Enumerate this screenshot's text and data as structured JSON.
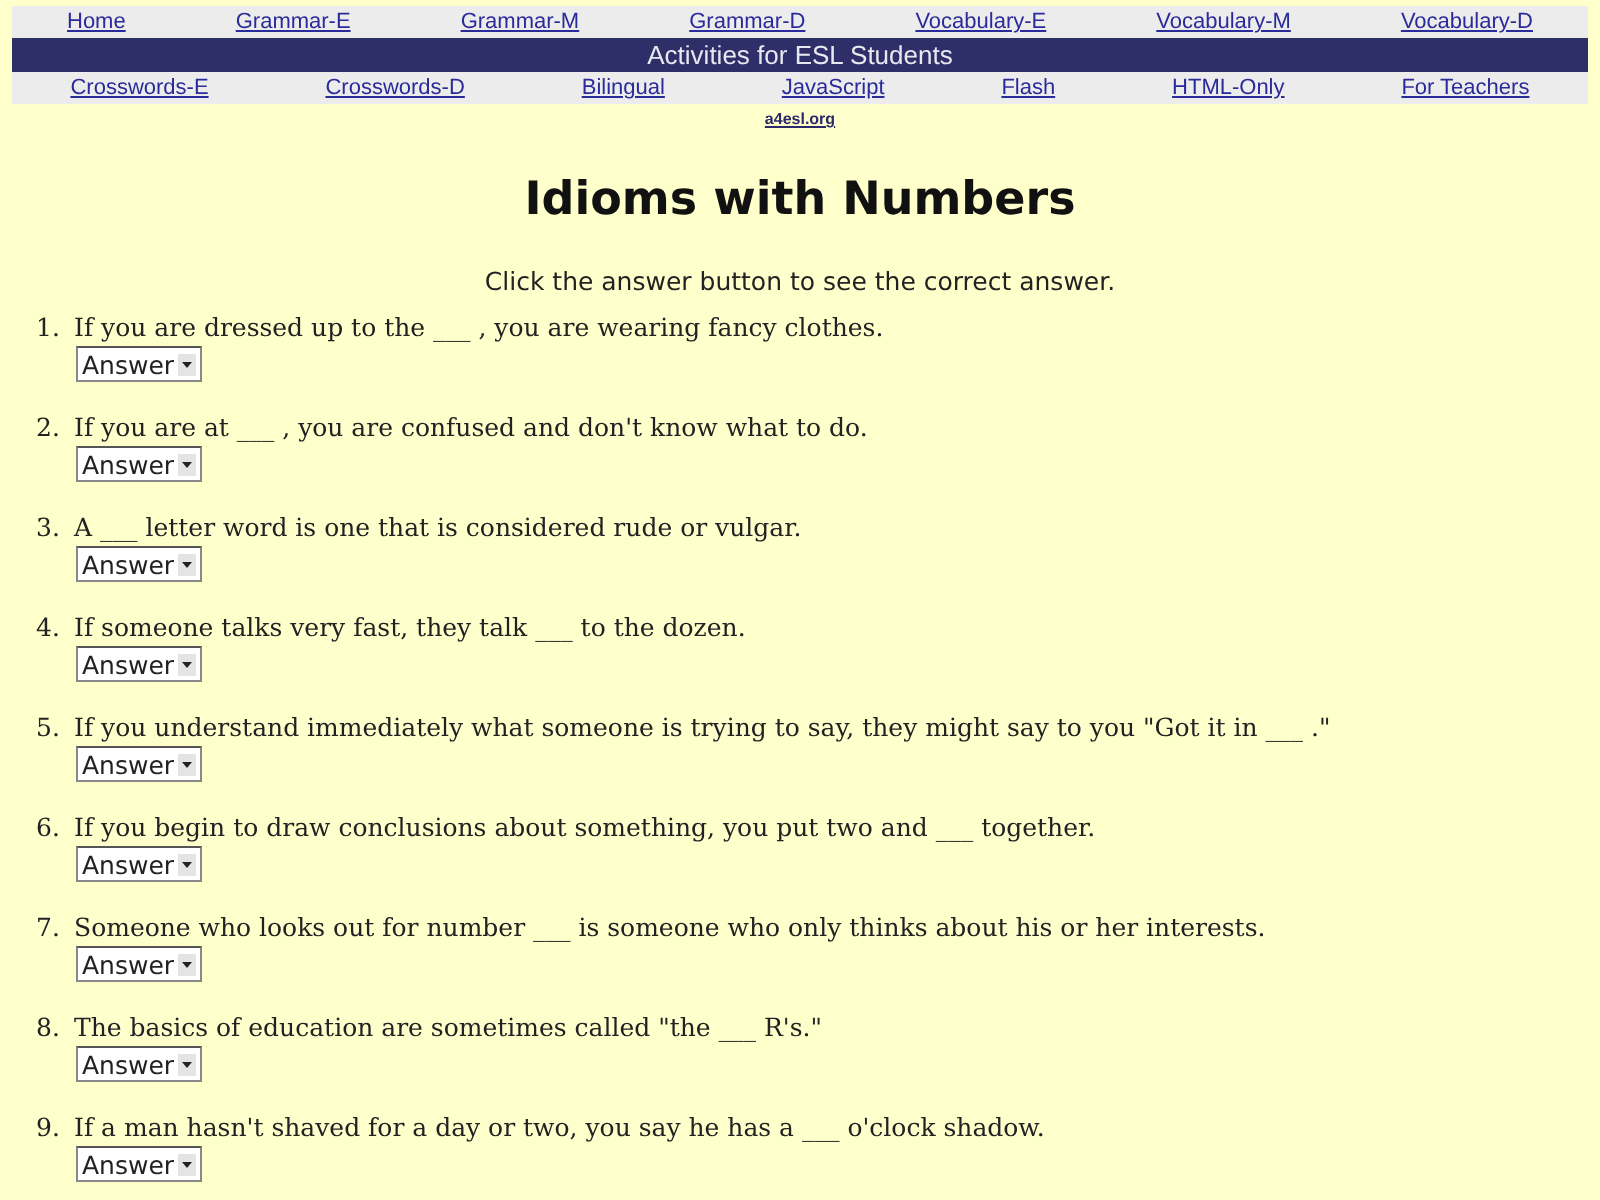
{
  "nav_top": [
    "Home",
    "Grammar-E",
    "Grammar-M",
    "Grammar-D",
    "Vocabulary-E",
    "Vocabulary-M",
    "Vocabulary-D"
  ],
  "banner": "Activities for ESL Students",
  "nav_bottom": [
    "Crosswords-E",
    "Crosswords-D",
    "Bilingual",
    "JavaScript",
    "Flash",
    "HTML-Only",
    "For Teachers"
  ],
  "site_link": "a4esl.org",
  "title": "Idioms with Numbers",
  "instruction": "Click the answer button to see the correct answer.",
  "questions": [
    {
      "number": "1.",
      "text": "If you are dressed up to the ___ , you are wearing fancy clothes.",
      "answer": "Answer"
    },
    {
      "number": "2.",
      "text": "If you are at ___ , you are confused and don't know what to do.",
      "answer": "Answer"
    },
    {
      "number": "3.",
      "text": "A ___ letter word is one that is considered rude or vulgar.",
      "answer": "Answer"
    },
    {
      "number": "4.",
      "text": "If someone talks very fast, they talk ___ to the dozen.",
      "answer": "Answer"
    },
    {
      "number": "5.",
      "text": "If you understand immediately what someone is trying to say, they might say to you \"Got it in ___ .\"",
      "answer": "Answer"
    },
    {
      "number": "6.",
      "text": "If you begin to draw conclusions about something, you put two and ___ together.",
      "answer": "Answer"
    },
    {
      "number": "7.",
      "text": "Someone who looks out for number ___ is someone who only thinks about his or her interests.",
      "answer": "Answer"
    },
    {
      "number": "8.",
      "text": "The basics of education are sometimes called \"the ___ R's.\"",
      "answer": "Answer"
    },
    {
      "number": "9.",
      "text": "If a man hasn't shaved for a day or two, you say he has a ___ o'clock shadow.",
      "answer": "Answer"
    }
  ]
}
